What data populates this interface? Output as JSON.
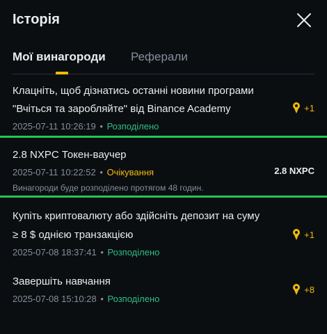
{
  "header": {
    "title": "Історія"
  },
  "tabs": [
    {
      "label": "Мої винагороди"
    },
    {
      "label": "Реферали"
    }
  ],
  "items": [
    {
      "title_line1": "Клацніть, щоб дізнатись останні новини програми",
      "title_line2": "\"Вчіться та заробляйте\" від Binance Academy",
      "datetime": "2025-07-11 10:26:19",
      "status": "Розподілено",
      "reward": "+1"
    },
    {
      "title_line1": "2.8 NXPC Токен-ваучер",
      "datetime": "2025-07-11 10:22:52",
      "status": "Очікування",
      "reward": "2.8 NXPC",
      "note": "Винагороди буде розподілено протягом 48 годин."
    },
    {
      "title_line1": "Купіть криптовалюту або здійсніть депозит на суму",
      "title_line2": "≥ 8 $ однією транзакцією",
      "datetime": "2025-07-08 18:37:41",
      "status": "Розподілено",
      "reward": "+1"
    },
    {
      "title_line1": "Завершіть навчання",
      "datetime": "2025-07-08 15:10:28",
      "status": "Розподілено",
      "reward": "+8"
    }
  ],
  "meta": {
    "separator": "•"
  },
  "colors": {
    "accent": "#f0b90b",
    "success": "#2ebd85",
    "highlight": "#1fc95a"
  },
  "icons": {
    "reward": "trophy-icon",
    "close": "close-icon"
  }
}
